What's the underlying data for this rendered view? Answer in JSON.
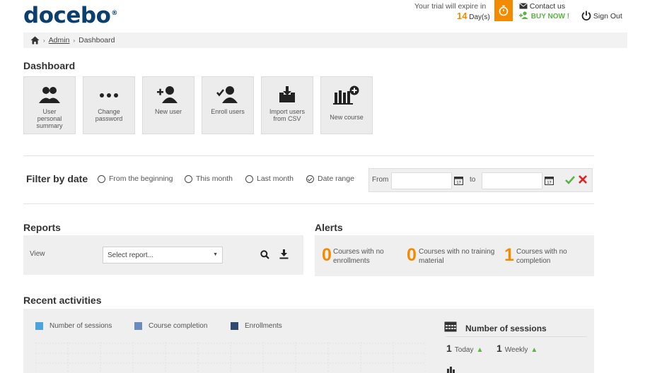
{
  "header": {
    "logo": "docebo",
    "logo_mark": "®",
    "trial_text": "Your trial will expire in",
    "trial_days_num": "14",
    "trial_days_unit": "Day(s)",
    "contact_label": "Contact us",
    "buy_label": "BUY NOW !",
    "signout_label": "Sign Out"
  },
  "breadcrumb": {
    "admin": "Admin",
    "current": "Dashboard"
  },
  "dashboard": {
    "title": "Dashboard",
    "tiles": [
      {
        "l1": "User",
        "l2": "personal",
        "l3": "summary"
      },
      {
        "l1": "Change",
        "l2": "password"
      },
      {
        "l1": "New user"
      },
      {
        "l1": "Enroll users"
      },
      {
        "l1": "Import users",
        "l2": "from CSV"
      },
      {
        "l1": "New course"
      }
    ]
  },
  "filter": {
    "title": "Filter by date",
    "options": [
      "From the beginning",
      "This month",
      "Last month",
      "Date range"
    ],
    "selected": "Date range",
    "from_label": "From",
    "to_label": "to",
    "from_value": "",
    "to_value": ""
  },
  "reports": {
    "title": "Reports",
    "view_label": "View",
    "select_placeholder": "Select report..."
  },
  "alerts": {
    "title": "Alerts",
    "items": [
      {
        "count": "0",
        "l1": "Courses with no",
        "l2": "enrollments"
      },
      {
        "count": "0",
        "l1": "Courses with no training",
        "l2": "material"
      },
      {
        "count": "1",
        "l1": "Courses with no",
        "l2": "completion"
      }
    ]
  },
  "recent": {
    "title": "Recent activities",
    "legend": [
      {
        "name": "Number of sessions",
        "color": "#4aa3df"
      },
      {
        "name": "Course completion",
        "color": "#6a8bbd"
      },
      {
        "name": "Enrollments",
        "color": "#2e4a6e"
      }
    ],
    "sessions_title": "Number of sessions",
    "today_value": "1",
    "today_label": "Today",
    "weekly_value": "1",
    "weekly_label": "Weekly"
  },
  "colors": {
    "brand": "#0b3f6e",
    "accent": "#f28b00",
    "green": "#5bb342",
    "red": "#e02020"
  }
}
